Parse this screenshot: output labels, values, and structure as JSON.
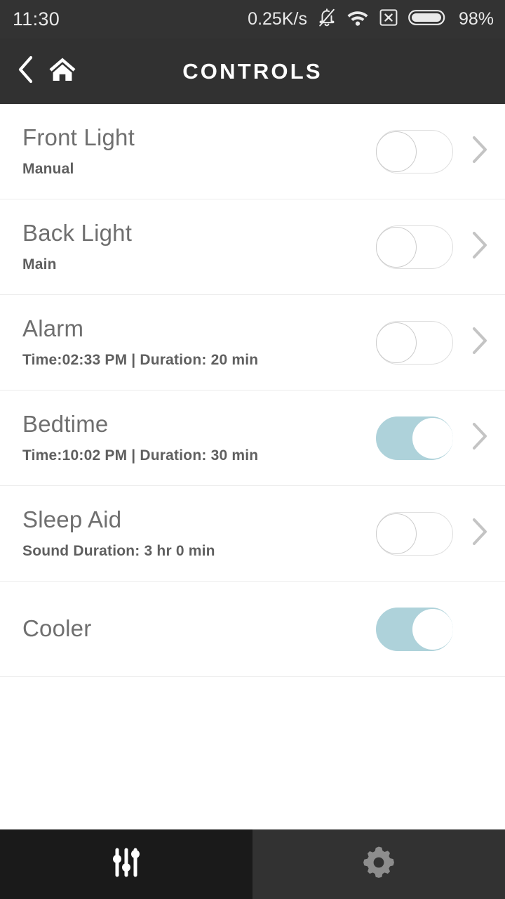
{
  "statusbar": {
    "time": "11:30",
    "network_speed": "0.25K/s",
    "battery_percent": "98%",
    "icons": [
      "bell-muted-icon",
      "wifi-icon",
      "sim-no-service-icon",
      "battery-icon"
    ]
  },
  "header": {
    "title": "CONTROLS",
    "back_label": "Back",
    "home_label": "Home"
  },
  "list": {
    "rows": [
      {
        "title": "Front Light",
        "subtitle": "Manual",
        "toggle_state": "off",
        "has_chevron": true
      },
      {
        "title": "Back Light",
        "subtitle": "Main",
        "toggle_state": "off",
        "has_chevron": true
      },
      {
        "title": "Alarm",
        "subtitle": "Time:02:33 PM | Duration: 20 min",
        "toggle_state": "off",
        "has_chevron": true
      },
      {
        "title": "Bedtime",
        "subtitle": "Time:10:02 PM | Duration: 30 min",
        "toggle_state": "on",
        "has_chevron": true
      },
      {
        "title": "Sleep Aid",
        "subtitle": "Sound Duration: 3 hr 0 min",
        "toggle_state": "off",
        "has_chevron": true
      },
      {
        "title": "Cooler",
        "subtitle": "",
        "toggle_state": "on",
        "has_chevron": false
      }
    ]
  },
  "bottomnav": {
    "tabs": [
      {
        "icon": "sliders-icon",
        "label": "Controls",
        "active": true
      },
      {
        "icon": "gear-icon",
        "label": "Settings",
        "active": false
      }
    ]
  },
  "colors": {
    "statusbar_bg": "#333333",
    "header_bg": "#313131",
    "toggle_on_track": "#aed2da",
    "toggle_off_border": "#dedede",
    "row_title": "#6f6f6f",
    "row_subtitle": "#5f5f5f",
    "divider": "#ececec",
    "nav_active_bg": "#1a1a1a",
    "nav_inactive_bg": "#323232",
    "nav_active_icon": "#ffffff",
    "nav_inactive_icon": "#8d8d8d",
    "chevron": "#c4c4c4"
  }
}
